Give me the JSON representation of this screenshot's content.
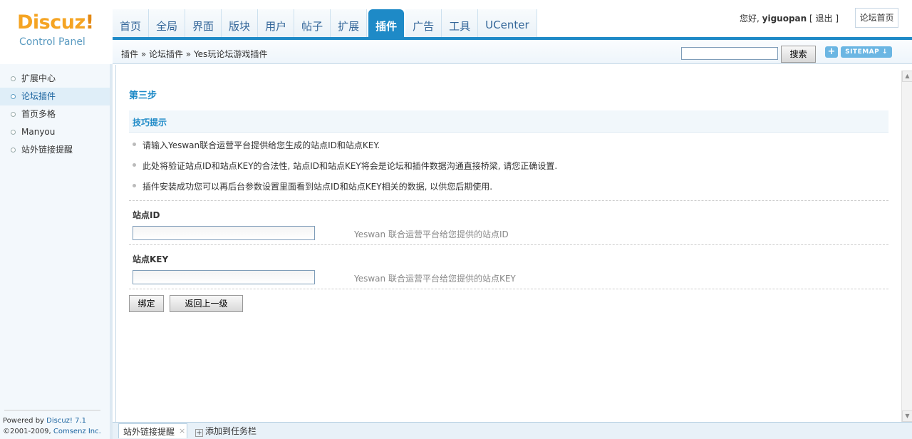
{
  "logo": {
    "brand": "Discuz",
    "bang": "!",
    "subtitle": "Control Panel"
  },
  "nav": {
    "tabs": [
      {
        "label": "首页"
      },
      {
        "label": "全局"
      },
      {
        "label": "界面"
      },
      {
        "label": "版块"
      },
      {
        "label": "用户"
      },
      {
        "label": "帖子"
      },
      {
        "label": "扩展"
      },
      {
        "label": "插件",
        "active": true
      },
      {
        "label": "广告"
      },
      {
        "label": "工具"
      },
      {
        "label": "UCenter"
      }
    ]
  },
  "user": {
    "greeting": "您好, ",
    "username": "yiguopan",
    "logout_open": " [ ",
    "logout": "退出",
    "logout_close": " ]"
  },
  "forum_home": "论坛首页",
  "breadcrumb": "插件 » 论坛插件 » Yes玩论坛游戏插件",
  "search": {
    "button": "搜索",
    "value": ""
  },
  "plus_label": "+",
  "sitemap_label": "SITEMAP ↓",
  "sidebar": {
    "items": [
      {
        "label": "扩展中心"
      },
      {
        "label": "论坛插件",
        "active": true
      },
      {
        "label": "首页多格"
      },
      {
        "label": "Manyou"
      },
      {
        "label": "站外链接提醒"
      }
    ]
  },
  "footer": {
    "powered_prefix": "Powered by ",
    "powered_link": "Discuz! 7.1",
    "copyright_prefix": "©2001-2009, ",
    "copyright_link": "Comsenz Inc."
  },
  "main": {
    "step_title": "第三步",
    "tips_header": "技巧提示",
    "tips": [
      "请输入Yeswan联合运营平台提供给您生成的站点ID和站点KEY.",
      "此处将验证站点ID和站点KEY的合法性, 站点ID和站点KEY将会是论坛和插件数据沟通直接桥梁, 请您正确设置.",
      "插件安装成功您可以再后台参数设置里面看到站点ID和站点KEY相关的数据, 以供您后期使用."
    ],
    "fields": [
      {
        "label": "站点ID",
        "value": "",
        "hint": "Yeswan 联合运营平台给您提供的站点ID"
      },
      {
        "label": "站点KEY",
        "value": "",
        "hint": "Yeswan 联合运营平台给您提供的站点KEY"
      }
    ],
    "bind_button": "绑定",
    "back_button": "返回上一级"
  },
  "taskbar": {
    "item": "站外链接提醒",
    "close": "×",
    "add_icon": "+",
    "add_label": "添加到任务栏"
  },
  "scrollbar": {
    "up": "▲",
    "down": "▼"
  },
  "colors": {
    "accent": "#1e8ac7",
    "logo": "#f5a423",
    "link": "#1b64a0"
  }
}
